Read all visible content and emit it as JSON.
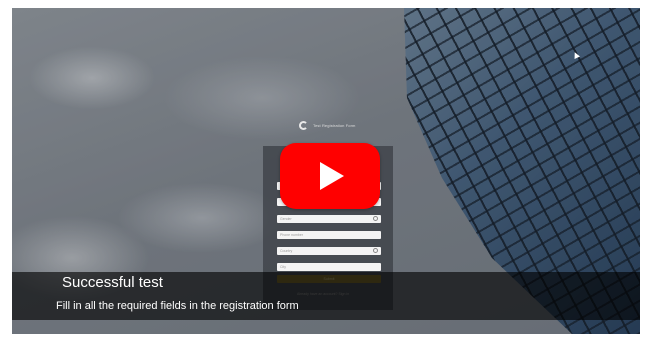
{
  "logo": {
    "text": "Test Registration Form"
  },
  "form": {
    "fields": [
      {
        "placeholder": ""
      },
      {
        "placeholder": ""
      },
      {
        "placeholder": "Gender"
      },
      {
        "placeholder": "Phone number"
      },
      {
        "placeholder": "Country"
      },
      {
        "placeholder": "City"
      }
    ],
    "submit_label": "Submit",
    "signin_text": "Already have an account? Sign in"
  },
  "video": {
    "caption_title": "Successful test",
    "caption_subtitle": "Fill in all the required fields in the registration form"
  },
  "colors": {
    "play_button": "#ff0000",
    "banner": "#000000",
    "submit": "#7a6a2a"
  },
  "icons": [
    "play-icon",
    "logo-icon",
    "dropdown-icon"
  ]
}
